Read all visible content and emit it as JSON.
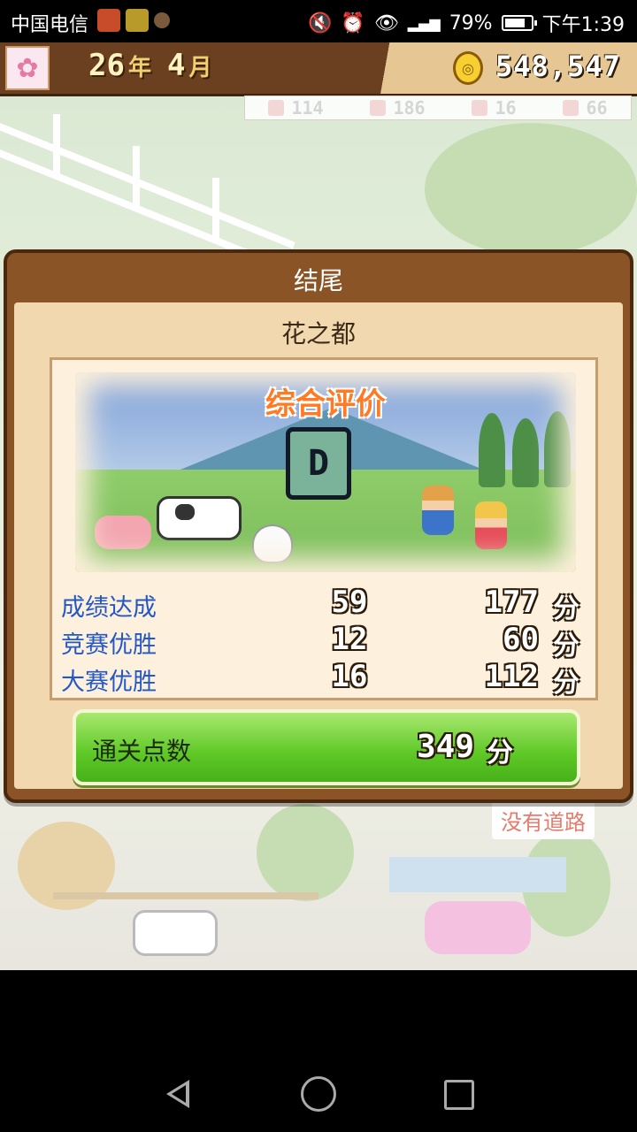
{
  "status_bar": {
    "carrier": "中国电信",
    "battery_percent": "79%",
    "battery_level": 0.79,
    "time": "下午1:39",
    "icons": [
      "mute-icon",
      "alarm-icon",
      "eye-icon",
      "signal-icon",
      "battery-icon"
    ]
  },
  "header": {
    "year_value": "26",
    "year_unit": "年",
    "month_value": "4",
    "month_unit": "月",
    "money": "548,547",
    "stats": [
      "114",
      "186",
      "16",
      "66"
    ]
  },
  "panel": {
    "title": "结尾",
    "subtitle": "花之都",
    "scene_title": "综合评价",
    "grade": "D",
    "rows": [
      {
        "label": "成绩达成",
        "count": "59",
        "points": "177",
        "unit": "分"
      },
      {
        "label": "竞赛优胜",
        "count": "12",
        "points": "60",
        "unit": "分"
      },
      {
        "label": "大赛优胜",
        "count": "16",
        "points": "112",
        "unit": "分"
      }
    ],
    "total": {
      "label": "通关点数",
      "value": "349",
      "unit": "分"
    }
  },
  "background": {
    "no_road_label": "没有道路"
  },
  "colors": {
    "panel_frame": "#8a5426",
    "panel_inner": "#f2d8ae",
    "label_blue": "#2458c6",
    "scene_title": "#ff7a22",
    "total_green": "#5ec826"
  }
}
